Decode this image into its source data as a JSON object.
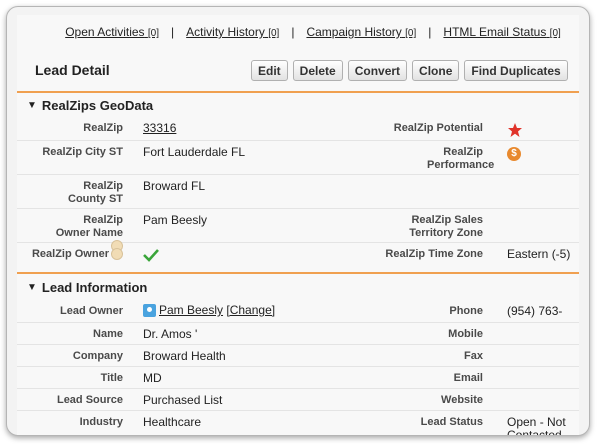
{
  "top_links": [
    {
      "label": "Open Activities",
      "count": "[0]"
    },
    {
      "label": "Activity History",
      "count": "[0]"
    },
    {
      "label": "Campaign History",
      "count": "[0]"
    },
    {
      "label": "HTML Email Status",
      "count": "[0]"
    }
  ],
  "separator": "|",
  "header": {
    "title": "Lead Detail",
    "buttons": [
      "Edit",
      "Delete",
      "Convert",
      "Clone",
      "Find Duplicates"
    ]
  },
  "geodata": {
    "title": "RealZips GeoData",
    "realzip_label": "RealZip",
    "realzip_value": "33316",
    "potential_label": "RealZip Potential",
    "potential_icon": "red-star-icon",
    "city_label": "RealZip City ST",
    "city_value": "Fort Lauderdale FL",
    "performance_label": "RealZip Performance",
    "performance_icon": "orange-dollar-icon",
    "performance_glyph": "$",
    "county_label": "RealZip County ST",
    "county_value": "Broward FL",
    "owner_name_label": "RealZip Owner Name",
    "owner_name_value": "Pam Beesly",
    "territory_label": "RealZip Sales Territory Zone",
    "territory_value": "",
    "owner_label": "RealZip Owner",
    "owner_icon": "green-check-icon",
    "timezone_label": "RealZip Time Zone",
    "timezone_value": "Eastern (-5)"
  },
  "lead_info": {
    "title": "Lead Information",
    "owner_label": "Lead Owner",
    "owner_value": "Pam Beesly",
    "change_label": "[Change]",
    "phone_label": "Phone",
    "phone_value": "(954) 763-",
    "name_label": "Name",
    "name_value": "Dr. Amos '",
    "mobile_label": "Mobile",
    "mobile_value": "",
    "company_label": "Company",
    "company_value": "Broward Health",
    "fax_label": "Fax",
    "fax_value": "",
    "title_label": "Title",
    "title_value": "MD",
    "email_label": "Email",
    "email_value": "",
    "source_label": "Lead Source",
    "source_value": "Purchased List",
    "website_label": "Website",
    "website_value": "",
    "industry_label": "Industry",
    "industry_value": "Healthcare",
    "status_label": "Lead Status",
    "status_value": "Open - Not Contacted"
  },
  "colors": {
    "accent": "#f0a050",
    "star": "#e0332a",
    "check": "#3aa53a",
    "coin": "#e8892e"
  }
}
